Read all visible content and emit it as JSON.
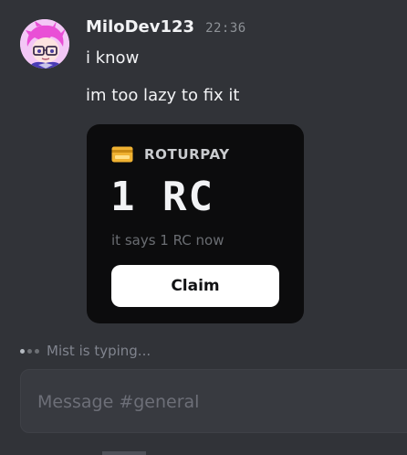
{
  "message": {
    "username": "MiloDev123",
    "timestamp": "22:36",
    "lines": [
      "i know",
      "im too lazy to fix it"
    ]
  },
  "card": {
    "brand": "ROTURPAY",
    "amount": "1 RC",
    "note": "it says 1 RC now",
    "button_label": "Claim",
    "icon": "credit-card-icon",
    "icon_color": "#f0b232"
  },
  "typing": {
    "text": "Mist is typing..."
  },
  "composer": {
    "placeholder": "Message #general"
  },
  "colors": {
    "background": "#313338",
    "card_bg": "#0c0c0d",
    "button_bg": "#ffffff"
  }
}
